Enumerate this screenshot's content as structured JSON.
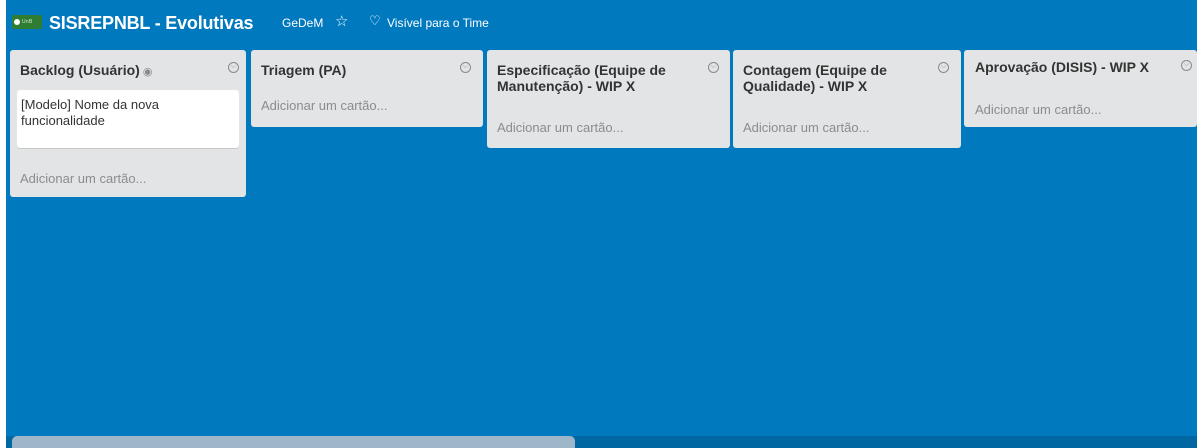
{
  "header": {
    "logo_text": "UnB",
    "board_title": "SISREPNBL - Evolutivas",
    "team": "GeDeM",
    "star": "☆",
    "visibility_icon": "team-icon",
    "visibility": "Visível para o Time"
  },
  "lists": [
    {
      "title": "Backlog (Usuário)",
      "watch_icon": "◉",
      "cards": [
        "[Modelo] Nome da nova funcionalidade"
      ],
      "add_card": "Adicionar um cartão..."
    },
    {
      "title": "Triagem (PA)",
      "cards": [],
      "add_card": "Adicionar um cartão..."
    },
    {
      "title": "Especificação (Equipe de Manutenção) - WIP X",
      "cards": [],
      "add_card": "Adicionar um cartão..."
    },
    {
      "title": "Contagem (Equipe de Qualidade) - WIP X",
      "cards": [],
      "add_card": "Adicionar um cartão..."
    },
    {
      "title": "Aprovação (DISIS) - WIP X",
      "cards": [],
      "add_card": "Adicionar um cartão..."
    }
  ],
  "colors": {
    "board_bg": "#0079bf",
    "list_bg": "#e2e4e6",
    "card_bg": "#ffffff",
    "scroll_thumb": "#9db6c9"
  }
}
